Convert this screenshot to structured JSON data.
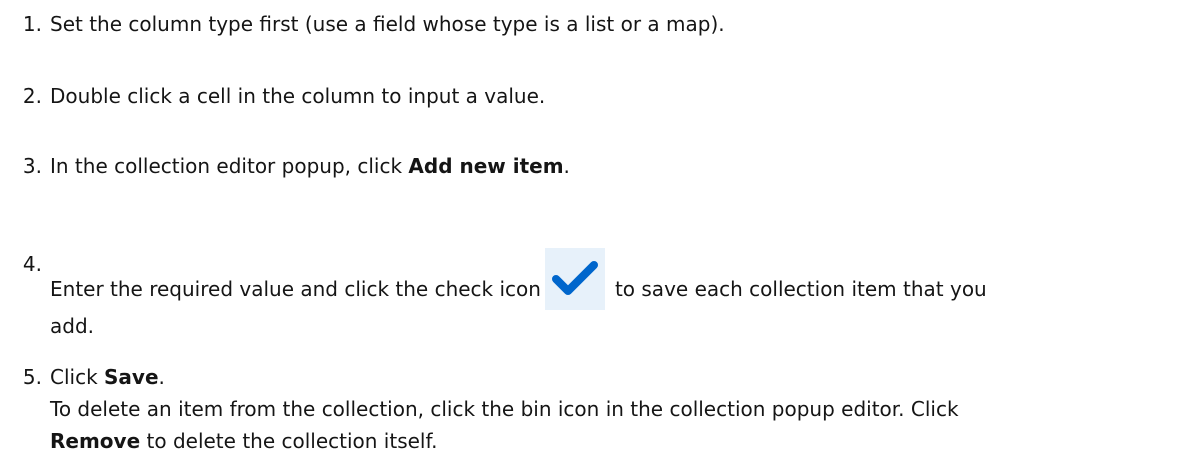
{
  "steps": [
    {
      "number": "1.",
      "text": "Set the column type first (use a field whose type is a list or a map)."
    },
    {
      "number": "2.",
      "text": "Double click a cell in the column to input a value."
    },
    {
      "number": "3.",
      "text_before": "In the collection editor popup, click ",
      "bold": "Add new item",
      "text_after": "."
    },
    {
      "number": "4.",
      "text_before": "Enter the required value and click the check icon",
      "icon": "check-icon",
      "text_after": "to save each collection item that you",
      "text_line2": "add."
    },
    {
      "number": "5.",
      "text_before": "Click ",
      "bold": "Save",
      "text_after": ".",
      "note_line1": "To delete an item from the collection, click the bin icon in the collection popup editor. Click",
      "note_bold": "Remove",
      "note_line2_after": " to delete the collection itself."
    }
  ],
  "colors": {
    "text": "#151515",
    "check_icon": "#0066cc",
    "check_background": "#e7f1fa"
  }
}
